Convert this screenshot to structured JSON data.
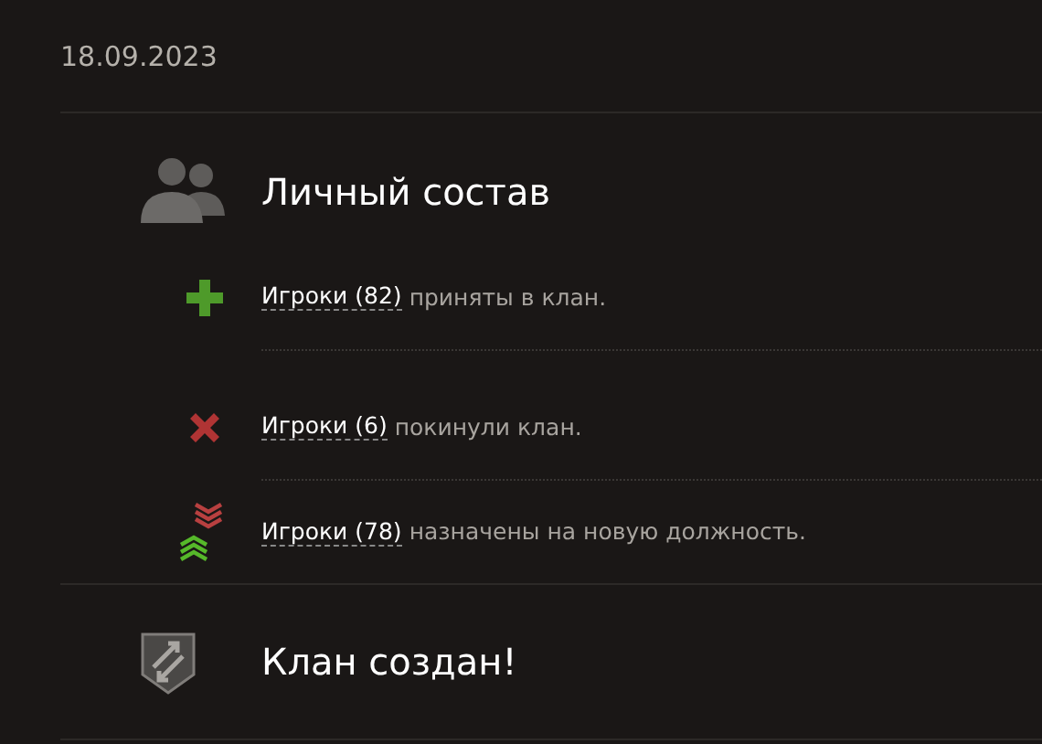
{
  "date": "18.09.2023",
  "sections": [
    {
      "kind": "personnel",
      "title": "Личный состав",
      "items": [
        {
          "kind": "joined",
          "link": "Игроки (82)",
          "text": "приняты в клан."
        },
        {
          "kind": "left",
          "link": "Игроки (6)",
          "text": "покинули клан."
        },
        {
          "kind": "promoted",
          "link": "Игроки (78)",
          "text": "назначены на новую должность."
        }
      ]
    },
    {
      "kind": "created",
      "title": "Клан создан!"
    }
  ]
}
